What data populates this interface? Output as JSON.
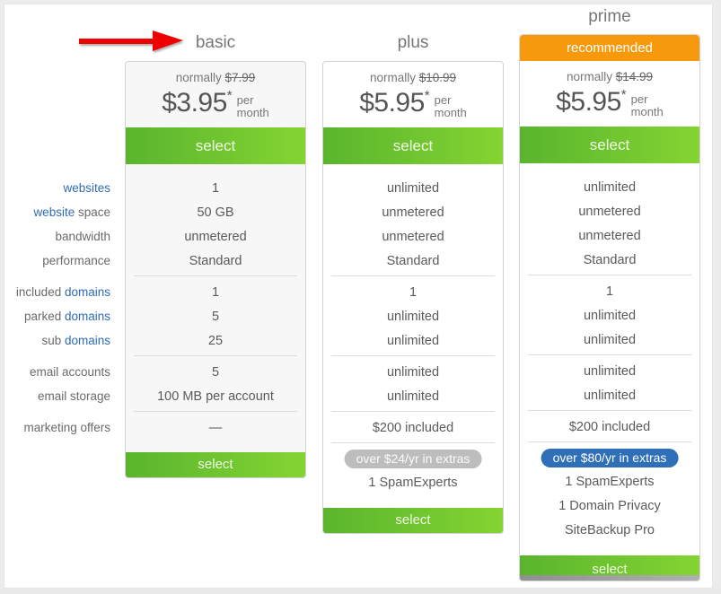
{
  "row_labels": [
    {
      "parts": [
        {
          "text": "websites",
          "highlight": true
        }
      ]
    },
    {
      "parts": [
        {
          "text": "website",
          "highlight": true
        },
        {
          "text": " space",
          "highlight": false
        }
      ]
    },
    {
      "parts": [
        {
          "text": "bandwidth",
          "highlight": false
        }
      ]
    },
    {
      "parts": [
        {
          "text": "performance",
          "highlight": false
        }
      ]
    },
    {
      "parts": [
        {
          "text": "included ",
          "highlight": false
        },
        {
          "text": "domains",
          "highlight": true
        }
      ]
    },
    {
      "parts": [
        {
          "text": "parked ",
          "highlight": false
        },
        {
          "text": "domains",
          "highlight": true
        }
      ]
    },
    {
      "parts": [
        {
          "text": "sub ",
          "highlight": false
        },
        {
          "text": "domains",
          "highlight": true
        }
      ]
    },
    {
      "parts": [
        {
          "text": "email accounts",
          "highlight": false
        }
      ]
    },
    {
      "parts": [
        {
          "text": "email storage",
          "highlight": false
        }
      ]
    },
    {
      "parts": [
        {
          "text": "marketing offers",
          "highlight": false
        }
      ]
    }
  ],
  "colors": {
    "accent_green_start": "#5ab52e",
    "accent_green_end": "#84d432",
    "recommended_orange": "#f7990c",
    "link_blue": "#2f6bb5",
    "pill_blue": "#2f6fb8",
    "pill_gray": "#bdbdbd",
    "arrow_red": "#ee0000"
  },
  "plans": [
    {
      "name": "basic",
      "normally_label": "normally",
      "normal_price": "$7.99",
      "price": "$3.95",
      "asterisk": "*",
      "per": "per",
      "month": "month",
      "select_label": "select",
      "values": [
        "1",
        "50 GB",
        "unmetered",
        "Standard",
        "1",
        "5",
        "25",
        "5",
        "100 MB per account",
        "—"
      ],
      "bottom_select_label": "select"
    },
    {
      "name": "plus",
      "normally_label": "normally",
      "normal_price": "$10.99",
      "price": "$5.95",
      "asterisk": "*",
      "per": "per",
      "month": "month",
      "select_label": "select",
      "values": [
        "unlimited",
        "unmetered",
        "unmetered",
        "Standard",
        "1",
        "unlimited",
        "unlimited",
        "unlimited",
        "unlimited",
        "$200 included"
      ],
      "extras_badge": "over $24/yr in extras",
      "extras": [
        "1 SpamExperts"
      ],
      "bottom_select_label": "select"
    },
    {
      "name": "prime",
      "ribbon": "recommended",
      "normally_label": "normally",
      "normal_price": "$14.99",
      "price": "$5.95",
      "asterisk": "*",
      "per": "per",
      "month": "month",
      "select_label": "select",
      "values": [
        "unlimited",
        "unmetered",
        "unmetered",
        "Standard",
        "1",
        "unlimited",
        "unlimited",
        "unlimited",
        "unlimited",
        "$200 included"
      ],
      "extras_badge": "over $80/yr in extras",
      "extras": [
        "1 SpamExperts",
        "1 Domain Privacy",
        "SiteBackup Pro"
      ],
      "bottom_select_label": "select"
    }
  ]
}
